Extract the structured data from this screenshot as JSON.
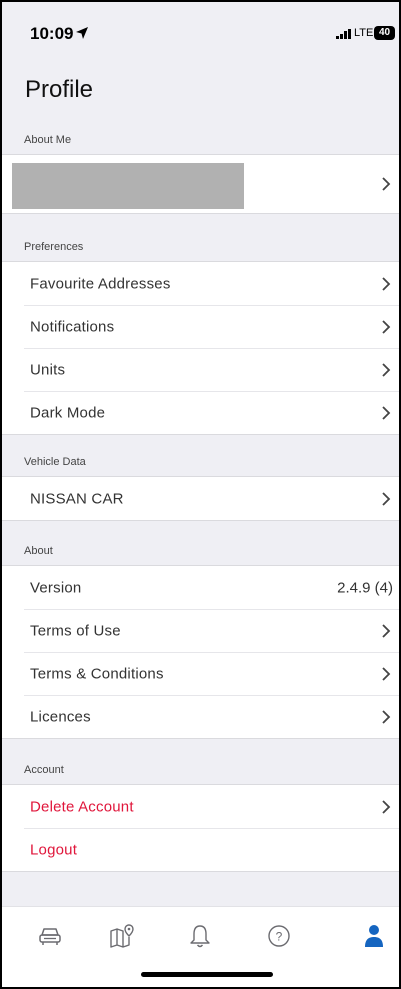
{
  "status": {
    "time": "10:09",
    "network": "LTE",
    "battery": "40"
  },
  "page": {
    "title": "Profile"
  },
  "sections": {
    "about_me": {
      "header": "About Me"
    },
    "preferences": {
      "header": "Preferences",
      "items": [
        "Favourite Addresses",
        "Notifications",
        "Units",
        "Dark Mode"
      ]
    },
    "vehicle": {
      "header": "Vehicle Data",
      "items": [
        "NISSAN CAR"
      ]
    },
    "about": {
      "header": "About",
      "version_label": "Version",
      "version_value": "2.4.9 (4)",
      "items": [
        "Terms of Use",
        "Terms & Conditions",
        "Licences"
      ]
    },
    "account": {
      "header": "Account",
      "items": [
        "Delete Account",
        "Logout"
      ]
    }
  },
  "tabbar": {
    "icons": [
      "car-icon",
      "map-icon",
      "bell-icon",
      "help-icon",
      "person-icon"
    ],
    "active_color": "#1565c0",
    "inactive_color": "#6b6b70"
  },
  "colors": {
    "danger": "#e0163b",
    "background": "#efeff4"
  }
}
